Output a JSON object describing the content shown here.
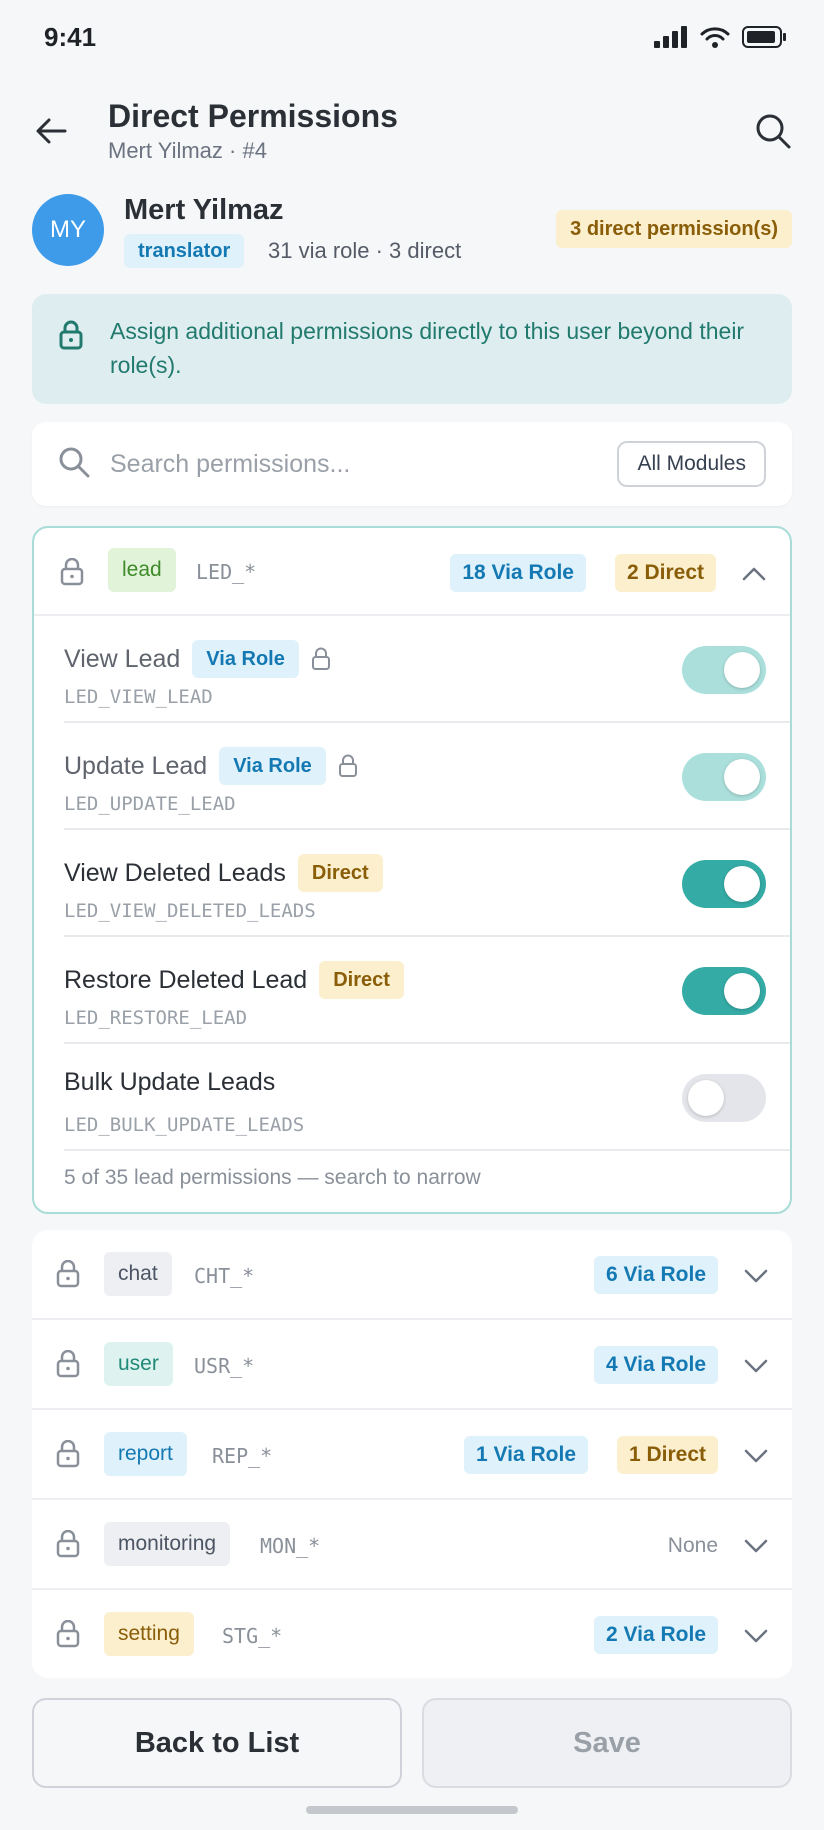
{
  "status_bar": {
    "time": "9:41"
  },
  "header": {
    "title": "Direct Permissions",
    "subtitle": "Mert Yilmaz · #4"
  },
  "user": {
    "initials": "MY",
    "name": "Mert Yilmaz",
    "role": "translator",
    "stats": "31 via role · 3 direct",
    "direct_count": "3 direct permission(s)",
    "avatar_color": "#3d9bea"
  },
  "info_banner": {
    "text": "Assign additional permissions directly to this user beyond their role(s)."
  },
  "search": {
    "placeholder": "Search permissions...",
    "value": "",
    "module_filter": "All Modules"
  },
  "expanded_module": {
    "tag": "lead",
    "code": "LED_*",
    "via_role": "18 Via Role",
    "direct": "2 Direct",
    "permissions": [
      {
        "name": "View Lead",
        "badge": "Via Role",
        "code": "LED_VIEW_LEAD",
        "state": "on-locked"
      },
      {
        "name": "Update Lead",
        "badge": "Via Role",
        "code": "LED_UPDATE_LEAD",
        "state": "on-locked"
      },
      {
        "name": "View Deleted Leads",
        "badge": "Direct",
        "code": "LED_VIEW_DELETED_LEADS",
        "state": "on"
      },
      {
        "name": "Restore Deleted Lead",
        "badge": "Direct",
        "code": "LED_RESTORE_LEAD",
        "state": "on"
      },
      {
        "name": "Bulk Update Leads",
        "badge": "",
        "code": "LED_BULK_UPDATE_LEADS",
        "state": "off"
      }
    ],
    "footer": "5 of 35 lead permissions — search to narrow"
  },
  "modules": [
    {
      "tag": "chat",
      "code": "CHT_*",
      "via_role": "6 Via Role",
      "direct": "",
      "none": ""
    },
    {
      "tag": "user",
      "code": "USR_*",
      "via_role": "4 Via Role",
      "direct": "",
      "none": ""
    },
    {
      "tag": "report",
      "code": "REP_*",
      "via_role": "1 Via Role",
      "direct": "1 Direct",
      "none": ""
    },
    {
      "tag": "monitoring",
      "code": "MON_*",
      "via_role": "",
      "direct": "",
      "none": "None"
    },
    {
      "tag": "setting",
      "code": "STG_*",
      "via_role": "2 Via Role",
      "direct": "",
      "none": ""
    }
  ],
  "actions": {
    "back": "Back to List",
    "save": "Save"
  },
  "colors": {
    "accent": "#35aba5",
    "via_role": "#1479b3",
    "direct": "#8a5d08"
  }
}
